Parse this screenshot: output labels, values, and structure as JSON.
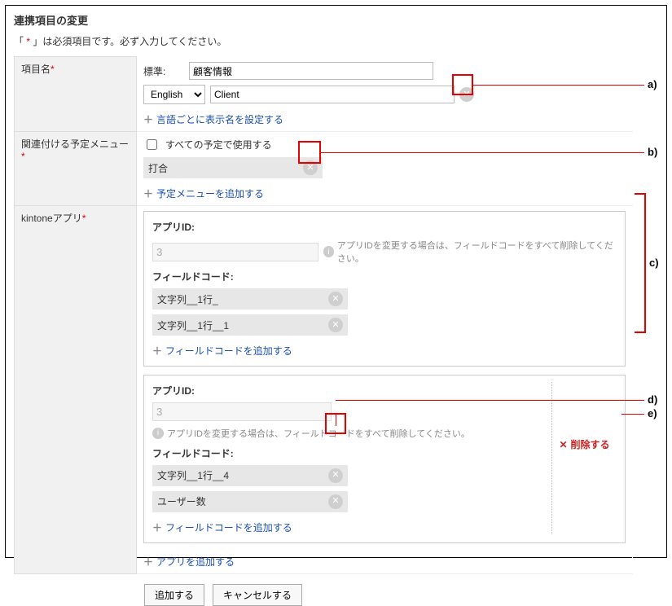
{
  "title": "連携項目の変更",
  "required_note_prefix": "「 ",
  "required_note_mark": "*",
  "required_note_suffix": " 」は必須項目です。必ず入力してください。",
  "labels": {
    "item_name": "項目名",
    "schedule_menu": "関連付ける予定メニュー",
    "kintone_app": "kintoneアプリ",
    "standard": "標準:",
    "app_id": "アプリID:",
    "field_code": "フィールドコード:"
  },
  "item_name": {
    "std_value": "顧客情報",
    "lang_select": "English",
    "lang_value": "Client",
    "add_lang_label": "言語ごとに表示名を設定する"
  },
  "schedule": {
    "checkbox_label": "すべての予定で使用する",
    "pill_value": "打合",
    "add_menu_label": "予定メニューを追加する"
  },
  "apps": [
    {
      "id_value": "3",
      "hint": "アプリIDを変更する場合は、フィールドコードをすべて削除してください。",
      "fields": [
        "文字列__1行_",
        "文字列__1行__1"
      ],
      "add_field_label": "フィールドコードを追加する",
      "deletable": false
    },
    {
      "id_value": "3",
      "hint": "アプリIDを変更する場合は、フィールドコードをすべて削除してください。",
      "fields": [
        "文字列__1行__4",
        "ユーザー数"
      ],
      "add_field_label": "フィールドコードを追加する",
      "deletable": true,
      "delete_label": "削除する"
    }
  ],
  "add_app_label": "アプリを追加する",
  "buttons": {
    "add": "追加する",
    "cancel": "キャンセルする"
  },
  "callouts": {
    "a": "a)",
    "b": "b)",
    "c": "c)",
    "d": "d)",
    "e": "e)"
  }
}
